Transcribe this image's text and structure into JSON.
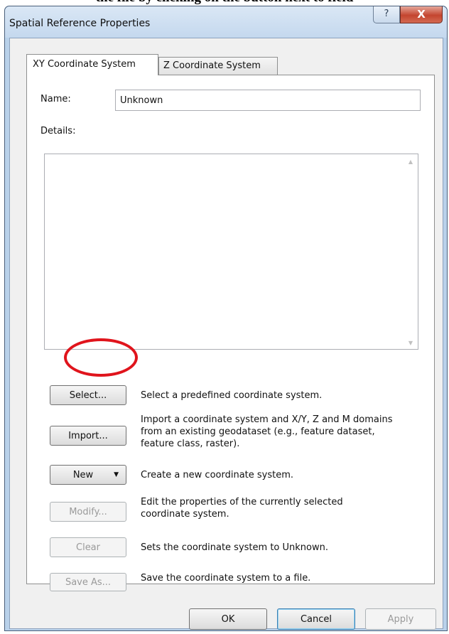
{
  "caption": "the file by clicking on the button next to field",
  "window": {
    "title": "Spatial Reference Properties",
    "help_glyph": "?",
    "close_glyph": "X"
  },
  "tabs": [
    {
      "label": "XY Coordinate System",
      "active": true
    },
    {
      "label": "Z Coordinate System",
      "active": false
    }
  ],
  "form": {
    "name_label": "Name:",
    "name_value": "Unknown",
    "details_label": "Details:"
  },
  "actions": [
    {
      "button": "Select...",
      "enabled": true,
      "description": "Select a predefined coordinate system."
    },
    {
      "button": "Import...",
      "enabled": true,
      "description": "Import a coordinate system and X/Y, Z and M domains from an existing geodataset (e.g., feature dataset, feature class, raster)."
    },
    {
      "button": "New",
      "enabled": true,
      "has_dropdown": true,
      "description": "Create a new coordinate system."
    },
    {
      "button": "Modify...",
      "enabled": false,
      "description": "Edit the properties of the currently selected coordinate system."
    },
    {
      "button": "Clear",
      "enabled": false,
      "description": "Sets the coordinate system to Unknown."
    },
    {
      "button": "Save As...",
      "enabled": false,
      "description": "Save the coordinate system to a file."
    }
  ],
  "footer": {
    "ok": "OK",
    "cancel": "Cancel",
    "apply": "Apply"
  },
  "colors": {
    "highlight_circle": "#e0141c",
    "window_frame": "#b9d1ea",
    "close_button": "#c4452f"
  }
}
